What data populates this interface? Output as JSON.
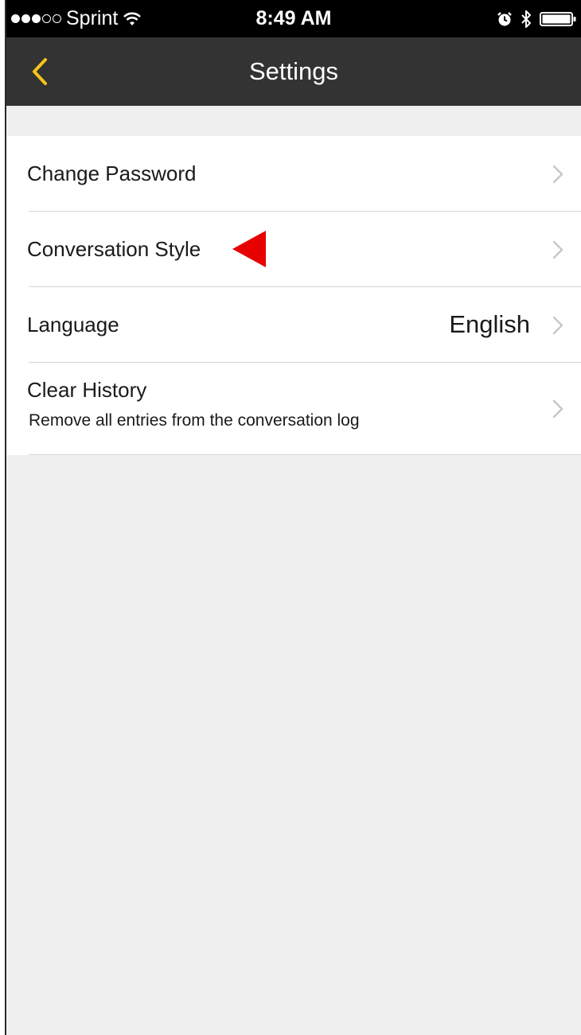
{
  "status_bar": {
    "carrier": "Sprint",
    "time": "8:49 AM",
    "signal_bars_filled": 3,
    "signal_bars_total": 5,
    "icons": [
      "wifi-icon",
      "alarm-icon",
      "bluetooth-icon",
      "battery-icon"
    ]
  },
  "nav": {
    "back_icon": "chevron-left-icon",
    "title": "Settings"
  },
  "settings": {
    "items": [
      {
        "label": "Change Password"
      },
      {
        "label": "Conversation Style",
        "annotation": "red-arrow-pointer"
      },
      {
        "label": "Language",
        "value": "English"
      },
      {
        "label": "Clear History",
        "sublabel": "Remove all entries from the conversation log"
      }
    ]
  },
  "colors": {
    "status_bar_bg": "#000000",
    "nav_bg": "#333333",
    "accent_back": "#f5c518",
    "page_bg": "#f0f0f0",
    "row_bg": "#ffffff",
    "separator": "#d6d6d6",
    "chevron": "#c7c7cc",
    "annotation_arrow": "#e60000"
  }
}
